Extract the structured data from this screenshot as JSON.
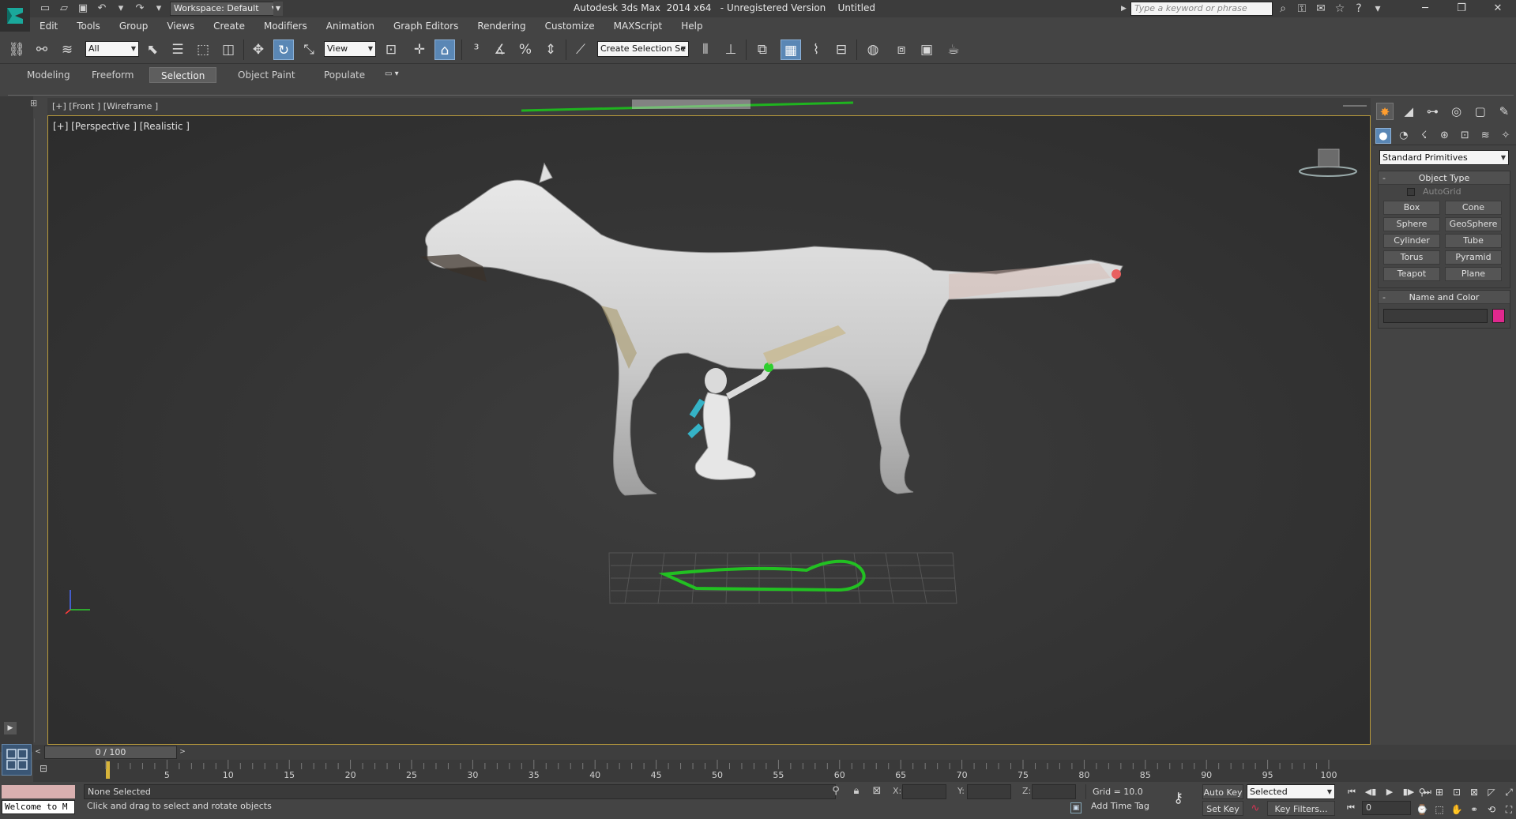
{
  "window": {
    "title": "Autodesk 3ds Max  2014 x64   - Unregistered Version    Untitled",
    "workspace_label": "Workspace: Default",
    "search_placeholder": "Type a keyword or phrase",
    "controls": [
      "minimize",
      "restore",
      "close"
    ]
  },
  "menu": {
    "items": [
      "Edit",
      "Tools",
      "Group",
      "Views",
      "Create",
      "Modifiers",
      "Animation",
      "Graph Editors",
      "Rendering",
      "Customize",
      "MAXScript",
      "Help"
    ]
  },
  "toolbar": {
    "selection_filter": "All",
    "reference_coord": "View",
    "named_selection": "Create Selection Se"
  },
  "ribbon": {
    "tabs": [
      "Modeling",
      "Freeform",
      "Selection",
      "Object Paint",
      "Populate"
    ],
    "active_tab": "Selection"
  },
  "viewports": {
    "front_label": "[+] [Front ] [Wireframe ]",
    "perspective_label": "[+] [Perspective ] [Realistic ]"
  },
  "command_panel": {
    "category_dropdown": "Standard Primitives",
    "object_type_title": "Object Type",
    "autogrid_label": "AutoGrid",
    "primitives": [
      "Box",
      "Cone",
      "Sphere",
      "GeoSphere",
      "Cylinder",
      "Tube",
      "Torus",
      "Pyramid",
      "Teapot",
      "Plane"
    ],
    "name_color_title": "Name and Color",
    "object_color": "#e0288e"
  },
  "timeline": {
    "slider_text": "0 / 100",
    "ticks": [
      5,
      10,
      15,
      20,
      25,
      30,
      35,
      40,
      45,
      50,
      55,
      60,
      65,
      70,
      75,
      80,
      85,
      90,
      95,
      100
    ]
  },
  "status": {
    "maxscript_listener": "Welcome to M",
    "selection_status": "None Selected",
    "prompt": "Click and drag to select and rotate objects",
    "x_label": "X:",
    "y_label": "Y:",
    "z_label": "Z:",
    "grid": "Grid = 10.0",
    "add_time_tag": "Add Time Tag",
    "auto_key": "Auto Key",
    "set_key": "Set Key",
    "key_mode": "Selected",
    "key_filters": "Key Filters...",
    "current_frame": "0"
  }
}
